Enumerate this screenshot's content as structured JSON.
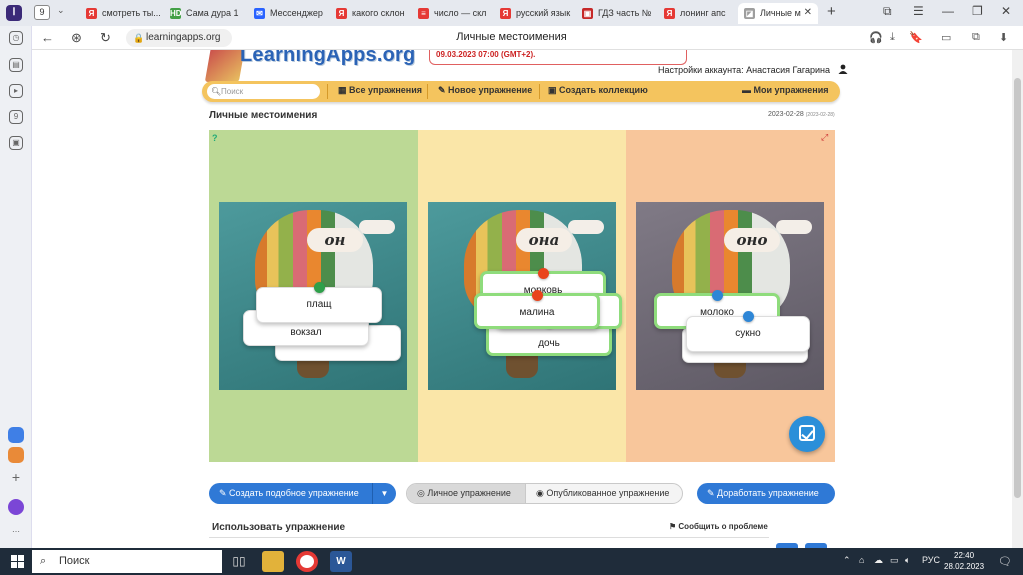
{
  "browser": {
    "tab_count": "9",
    "tabs": [
      {
        "label": "смотреть ты...",
        "fav": "Я",
        "fav_color": "#e53935"
      },
      {
        "label": "Сама дура 1",
        "fav": "HD",
        "fav_color": "#43a047"
      },
      {
        "label": "Мессенджер",
        "fav": "✉",
        "fav_color": "#2962ff"
      },
      {
        "label": "какого склон",
        "fav": "Я",
        "fav_color": "#e53935"
      },
      {
        "label": "число — скл",
        "fav": "≡",
        "fav_color": "#e53935"
      },
      {
        "label": "русский язык",
        "fav": "Я",
        "fav_color": "#e53935"
      },
      {
        "label": "ГДЗ часть №",
        "fav": "▣",
        "fav_color": "#c62828"
      },
      {
        "label": "лонинг апс",
        "fav": "Я",
        "fav_color": "#e53935"
      },
      {
        "label": "Личные м",
        "fav": "◪",
        "fav_color": "#9e9e9e"
      }
    ],
    "url": "learningapps.org",
    "page_title": "Личные местоимения"
  },
  "site": {
    "logo": "LearningApps.org",
    "notice": "09.03.2023 07:00 (GMT+2).",
    "account_label": "Настройки аккаунта: Анастасия Гагарина"
  },
  "toolbar": {
    "search_placeholder": "Поиск",
    "all_exercises": "Все упражнения",
    "new_exercise": "Новое упражнение",
    "create_collection": "Создать коллекцию",
    "my_exercises": "Мои упражнения"
  },
  "exercise": {
    "title": "Личные местоимения",
    "date": "2023-02-28",
    "date_small": "(2023-02-28)",
    "columns": [
      {
        "pronoun": "он",
        "color": "#bcd995",
        "cards": [
          "плащ",
          "вокзал"
        ]
      },
      {
        "pronoun": "она",
        "color": "#fae6a8",
        "cards": [
          "морковь",
          "малина",
          "дочь"
        ]
      },
      {
        "pronoun": "оно",
        "color": "#f8c69b",
        "cards": [
          "молоко",
          "сукно"
        ]
      }
    ]
  },
  "actions": {
    "create_similar": "Создать подобное упражнение",
    "private": "Личное упражнение",
    "published": "Опубликованное упражнение",
    "edit": "Доработать упражнение"
  },
  "use": {
    "title": "Использовать упражнение",
    "report": "Сообщить о проблеме"
  },
  "taskbar": {
    "search": "Поиск",
    "lang": "РУС",
    "time": "22:40",
    "date": "28.02.2023"
  }
}
